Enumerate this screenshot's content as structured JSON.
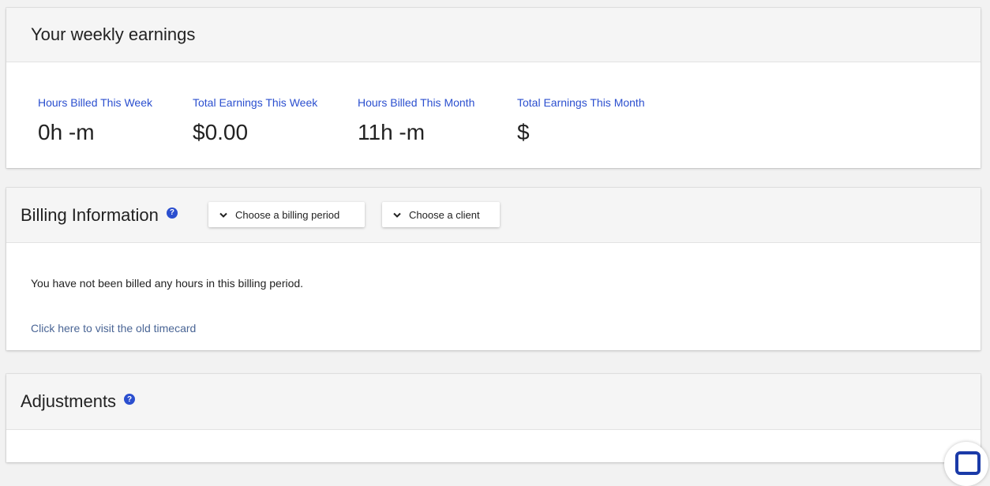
{
  "earnings": {
    "title": "Your weekly earnings",
    "stats": [
      {
        "label": "Hours Billed This Week",
        "value": "0h -m"
      },
      {
        "label": "Total Earnings This Week",
        "value": "$0.00"
      },
      {
        "label": "Hours Billed This Month",
        "value": "11h -m"
      },
      {
        "label": "Total Earnings This Month",
        "value": "$"
      }
    ]
  },
  "billing": {
    "title": "Billing Information",
    "help_icon": "question-circle-icon",
    "period_dropdown": "Choose a billing period",
    "client_dropdown": "Choose a client",
    "message": "You have not been billed any hours in this billing period.",
    "old_timecard_link": "Click here to visit the old timecard"
  },
  "adjustments": {
    "title": "Adjustments",
    "help_icon": "question-circle-icon"
  },
  "chat_widget": {
    "icon": "chat-icon"
  },
  "colors": {
    "accent": "#2b4fcf",
    "link": "#4a6595",
    "header_bg": "#f5f5f5"
  }
}
